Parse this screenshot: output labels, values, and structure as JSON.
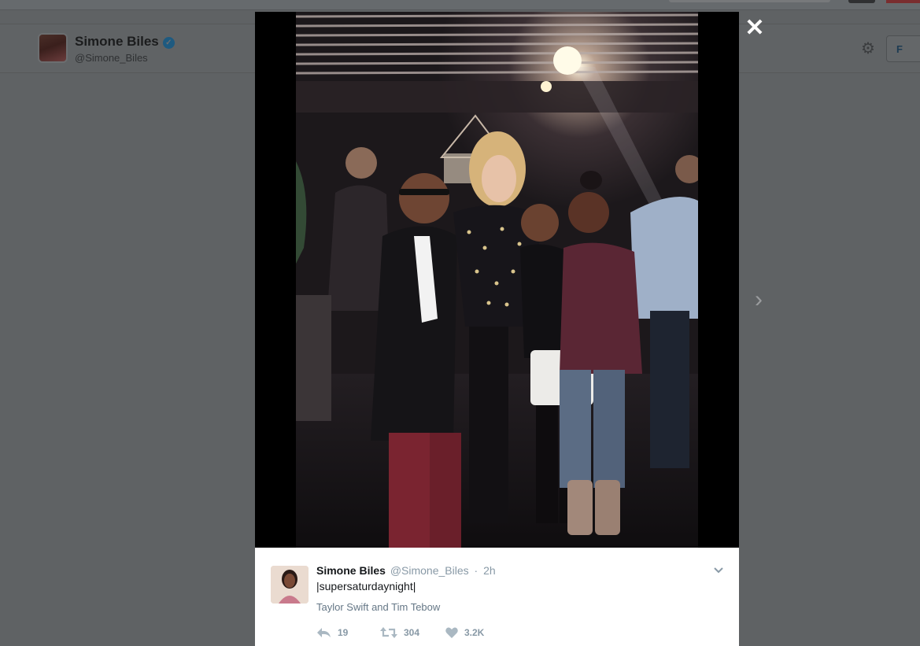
{
  "profile": {
    "name": "Simone Biles",
    "handle": "@Simone_Biles",
    "follow_label": "F"
  },
  "icons": {
    "close": "close-icon",
    "next": "chevron-right-icon",
    "gear": "gear-icon",
    "verified": "verified-badge-icon",
    "reply": "reply-icon",
    "retweet": "retweet-icon",
    "like": "heart-icon",
    "caret": "chevron-down-icon"
  },
  "colors": {
    "overlay": "#5f6264",
    "verified": "#1da1f2",
    "meta_text": "#8899a6"
  },
  "modal": {
    "close_symbol": "✕",
    "next_symbol": "›"
  },
  "tweet": {
    "author_name": "Simone Biles",
    "author_handle": "@Simone_Biles",
    "separator": "·",
    "time": "2h",
    "text": "|supersaturdaynight|",
    "tagged": "Taylor Swift and Tim Tebow",
    "stats": {
      "replies": "19",
      "retweets": "304",
      "likes": "3.2K"
    }
  }
}
